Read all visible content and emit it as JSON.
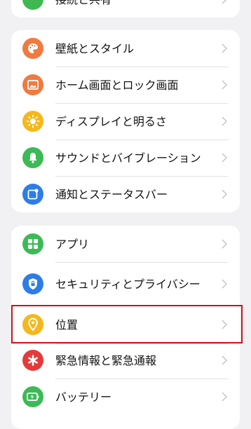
{
  "top_partial": {
    "label": "接続と共有",
    "icon": "share-icon",
    "color": "#3fb84f"
  },
  "group1": [
    {
      "label": "壁紙とスタイル",
      "icon": "palette-icon",
      "color": "#f07a3f"
    },
    {
      "label": "ホーム画面とロック画面",
      "icon": "image-icon",
      "color": "#f07a3f"
    },
    {
      "label": "ディスプレイと明るさ",
      "icon": "sun-icon",
      "color": "#f6b71c"
    },
    {
      "label": "サウンドとバイブレーション",
      "icon": "bell-icon",
      "color": "#3cba56"
    },
    {
      "label": "通知とステータスバー",
      "icon": "notification-icon",
      "color": "#2d7de6"
    }
  ],
  "group2": [
    {
      "label": "アプリ",
      "icon": "apps-grid-icon",
      "color": "#3cba56"
    },
    {
      "label": "セキュリティとプライバシー",
      "icon": "lock-icon",
      "color": "#2d7de6"
    },
    {
      "label": "位置",
      "icon": "location-pin-icon",
      "color": "#f6b71c"
    },
    {
      "label": "緊急情報と緊急通報",
      "icon": "asterisk-icon",
      "color": "#e53a3a"
    },
    {
      "label": "バッテリー",
      "icon": "battery-icon",
      "color": "#3cba56"
    }
  ],
  "highlight_color": "#d50f12"
}
